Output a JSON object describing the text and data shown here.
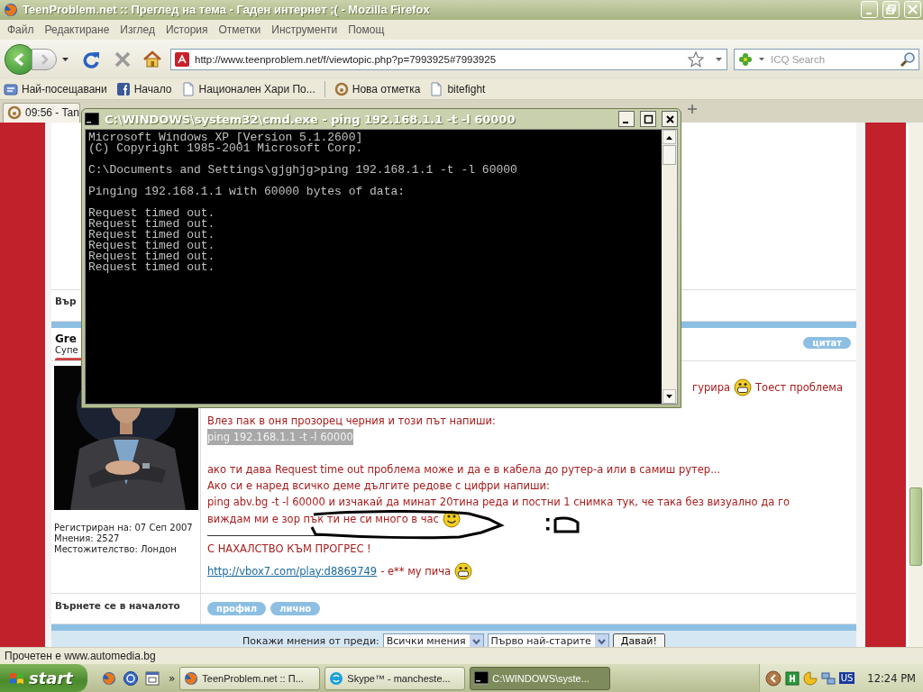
{
  "browser": {
    "title": "TeenProblem.net :: Преглед на тема - Гаден интернет ;( - Mozilla Firefox",
    "menu": [
      "Файл",
      "Редактиране",
      "Изглед",
      "История",
      "Отметки",
      "Инструменти",
      "Помощ"
    ],
    "url": "http://www.teenproblem.net/f/viewtopic.php?p=7993925#7993925",
    "search": {
      "placeholder": "ICQ Search"
    },
    "bookmarks": [
      {
        "kind": "smart",
        "label": "Най-посещавани"
      },
      {
        "kind": "social",
        "label": "Начало"
      },
      {
        "kind": "page",
        "label": "Национален Хари По..."
      },
      {
        "kind": "separator"
      },
      {
        "kind": "ring",
        "label": "Нова отметка"
      },
      {
        "kind": "page",
        "label": "bitefight"
      }
    ],
    "tabs": [
      {
        "label": "09:56 - Tan",
        "selected": true
      }
    ],
    "status_bar": "Прочетен е www.automedia.bg"
  },
  "forum": {
    "back_link_cut": "Вър",
    "post": {
      "author": "Gre",
      "rank": "Супе",
      "quote_button": "цитат",
      "profile": [
        "Регистриран на: 07 Сеп 2007",
        "Мнения: 2527",
        "Местожителство: Лондон"
      ],
      "paragraphs": [
        [
          {
            "kind": "covered",
            "parts": [
              {
                "kind": "text",
                "text": "гурира"
              },
              {
                "kind": "grin"
              },
              {
                "kind": "text",
                "text": "Тоест проблема"
              }
            ]
          }
        ],
        [
          {
            "kind": "text",
            "parts": [
              {
                "kind": "text",
                "text": "Влез пак в оня прозорец черния и този път напиши:"
              }
            ]
          },
          {
            "kind": "highlight",
            "parts": [
              {
                "kind": "text",
                "text": "ping 192.168.1.1 -t -l 60000"
              }
            ]
          }
        ],
        [
          {
            "kind": "text",
            "parts": [
              {
                "kind": "text",
                "text": "ако ти дава Request time out проблема може и да е в кабела до рутер-а или в самиш рутер..."
              }
            ]
          },
          {
            "kind": "text",
            "parts": [
              {
                "kind": "text",
                "text": "Ако си е наред всичко деме дългите редове с цифри напиши:"
              }
            ]
          },
          {
            "kind": "text",
            "parts": [
              {
                "kind": "text",
                "text": "ping abv.bg -t -l 60000 и изчакай да минат 20тина реда и постни 1 снимка тук, че така без визуално да го"
              }
            ]
          },
          {
            "kind": "text",
            "parts": [
              {
                "kind": "text",
                "text": "виждам ми е зор пък ти не си много в час"
              },
              {
                "kind": "smile"
              }
            ]
          }
        ]
      ],
      "signature": [
        {
          "parts": [
            {
              "kind": "text",
              "text": "С НАХАЛСТВО КЪМ ПРОГРЕС !"
            }
          ]
        },
        {
          "parts": [
            {
              "kind": "link",
              "text": "http://vbox7.com/play:d8869749"
            },
            {
              "kind": "text",
              "text": "- е** му пича"
            },
            {
              "kind": "grin"
            }
          ]
        }
      ]
    },
    "back_to_top": "Върнете се в началото",
    "post_buttons": [
      "профил",
      "лично"
    ],
    "footer": {
      "label": "Покажи мнения от преди:",
      "selects": [
        "Всички мнения",
        "Първо най-старите"
      ],
      "button": "Давай!"
    }
  },
  "cmd": {
    "title": "C:\\WINDOWS\\system32\\cmd.exe - ping 192.168.1.1 -t -l 60000",
    "blocks": [
      [
        "Microsoft Windows XP [Version 5.1.2600]",
        "(C) Copyright 1985-2001 Microsoft Corp."
      ],
      [
        "C:\\Documents and Settings\\gjghjg>ping 192.168.1.1 -t -l 60000"
      ],
      [
        "Pinging 192.168.1.1 with 60000 bytes of data:"
      ],
      [
        "Request timed out.",
        "Request timed out.",
        "Request timed out.",
        "Request timed out.",
        "Request timed out.",
        "Request timed out."
      ]
    ]
  },
  "taskbar": {
    "start": "start",
    "quick_launch": [
      {
        "kind": "browser"
      },
      {
        "kind": "badge"
      },
      {
        "kind": "window"
      }
    ],
    "overflow": "»",
    "tasks": [
      {
        "kind": "browser",
        "label": "TeenProblem.net :: П...",
        "selected": false
      },
      {
        "kind": "chat",
        "label": "Skype™ - mancheste...",
        "selected": false
      },
      {
        "kind": "console",
        "label": "C:\\WINDOWS\\syste...",
        "selected": true
      }
    ],
    "language": "US",
    "clock": "12:24 PM"
  }
}
